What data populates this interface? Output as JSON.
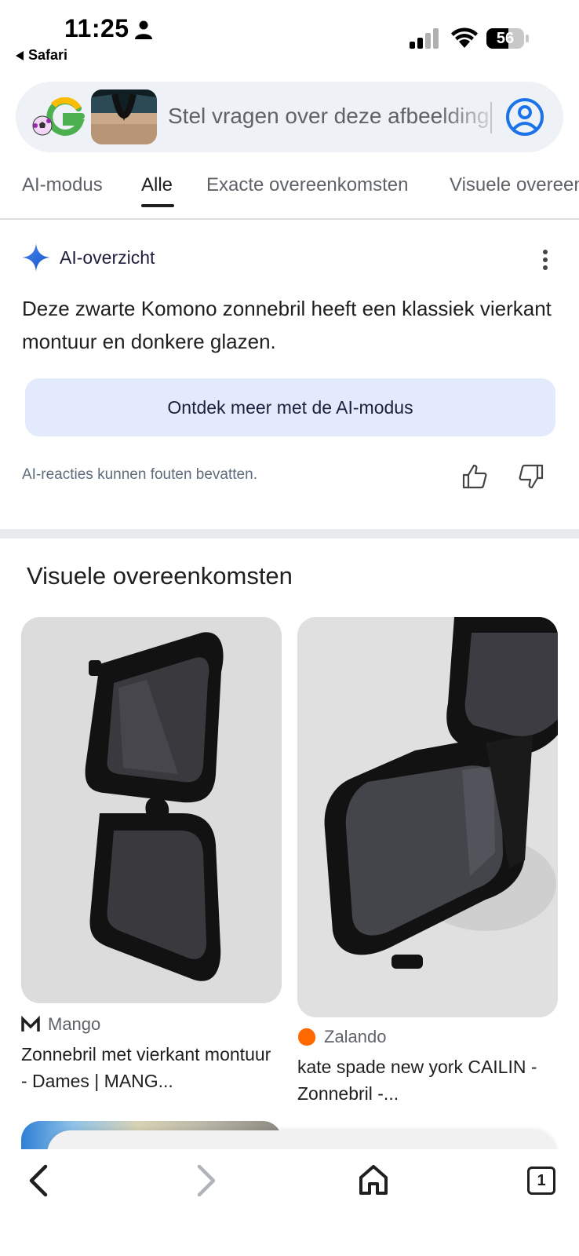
{
  "status_bar": {
    "time": "11:25",
    "back_app": "Safari",
    "battery": "56"
  },
  "search": {
    "placeholder": "Stel vragen over deze afbeelding"
  },
  "tabs": [
    {
      "label": "AI-modus"
    },
    {
      "label": "Alle"
    },
    {
      "label": "Exacte overeenkomsten"
    },
    {
      "label": "Visuele overeenkomsten"
    }
  ],
  "ai_overview": {
    "title": "AI-overzicht",
    "text": "Deze zwarte Komono zonnebril heeft een klassiek vierkant montuur en donkere glazen.",
    "button": "Ontdek meer met de AI-modus",
    "disclaimer": "AI-reacties kunnen fouten bevatten."
  },
  "visual_matches": {
    "title": "Visuele overeenkomsten",
    "results": [
      {
        "source": "Mango",
        "title": "Zonnebril met vierkant montuur - Dames | MANG..."
      },
      {
        "source": "Zalando",
        "title": "kate spade new york CAILIN - Zonnebril -..."
      }
    ]
  },
  "toolbar": {
    "tab_count": "1"
  },
  "colors": {
    "accent_blue": "#1a73e8",
    "ai_button_bg": "#e3eafc",
    "zalando_orange": "#ff6900"
  }
}
